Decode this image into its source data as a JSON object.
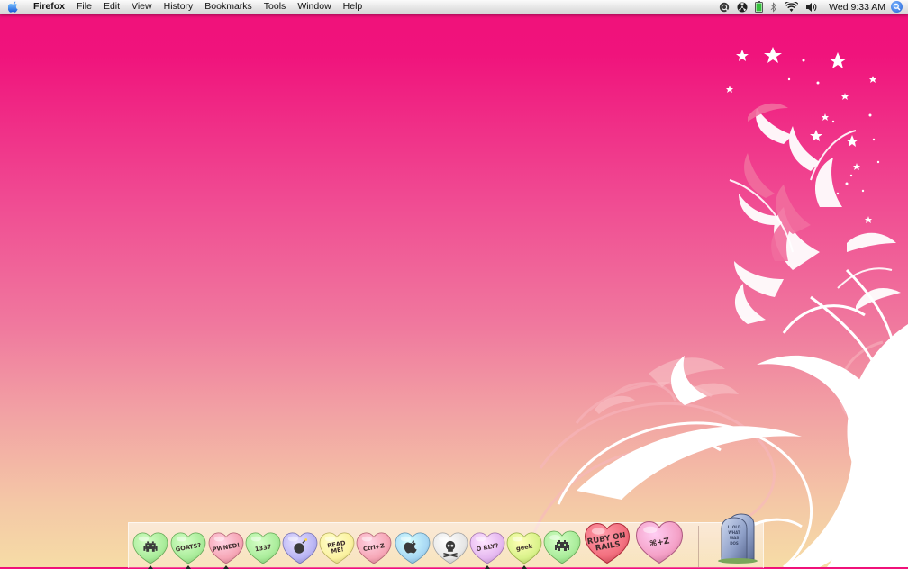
{
  "menubar": {
    "app_name": "Firefox",
    "menus": [
      "File",
      "Edit",
      "View",
      "History",
      "Bookmarks",
      "Tools",
      "Window",
      "Help"
    ],
    "clock": "Wed 9:33 AM",
    "status_icons": [
      "quicksilver-icon",
      "radioactive-icon",
      "battery-icon",
      "bluetooth-icon",
      "wifi-icon",
      "volume-icon",
      "spotlight-icon"
    ]
  },
  "dock": {
    "items": [
      {
        "name": "space-invader",
        "label": "",
        "color": "#a9ec9a",
        "running": true
      },
      {
        "name": "goats",
        "label": "GOATS?",
        "color": "#a9ec9a",
        "running": true
      },
      {
        "name": "pwned",
        "label": "PWNED!",
        "color": "#f6a6b6",
        "running": true
      },
      {
        "name": "1337",
        "label": "1337",
        "color": "#a9ec9a",
        "running": false
      },
      {
        "name": "bomb",
        "label": "",
        "color": "#b9b4f4",
        "running": false
      },
      {
        "name": "read-me",
        "label": "READ ME!",
        "color": "#fbf2a0",
        "running": false
      },
      {
        "name": "ctrl-z",
        "label": "Ctrl+Z",
        "color": "#f6a6b6",
        "running": false
      },
      {
        "name": "apple",
        "label": "",
        "color": "#a8d8f4",
        "running": false
      },
      {
        "name": "skull",
        "label": "",
        "color": "#e6e6e6",
        "running": false
      },
      {
        "name": "o-rly",
        "label": "O RLY?",
        "color": "#e5b8f0",
        "running": true
      },
      {
        "name": "geek",
        "label": "geek",
        "color": "#d9f28a",
        "running": true
      },
      {
        "name": "invader-2",
        "label": "",
        "color": "#a9ec9a",
        "running": false
      },
      {
        "name": "ruby-on-rails",
        "label": "RUBY ON RAILS",
        "color": "#f26f7e",
        "running": false
      },
      {
        "name": "cmd-z",
        "label": "⌘+Z",
        "color": "#f4a0c6",
        "running": false
      }
    ],
    "trash": {
      "name": "trash",
      "label": "I LOLD WHAT WAS DOS"
    }
  }
}
